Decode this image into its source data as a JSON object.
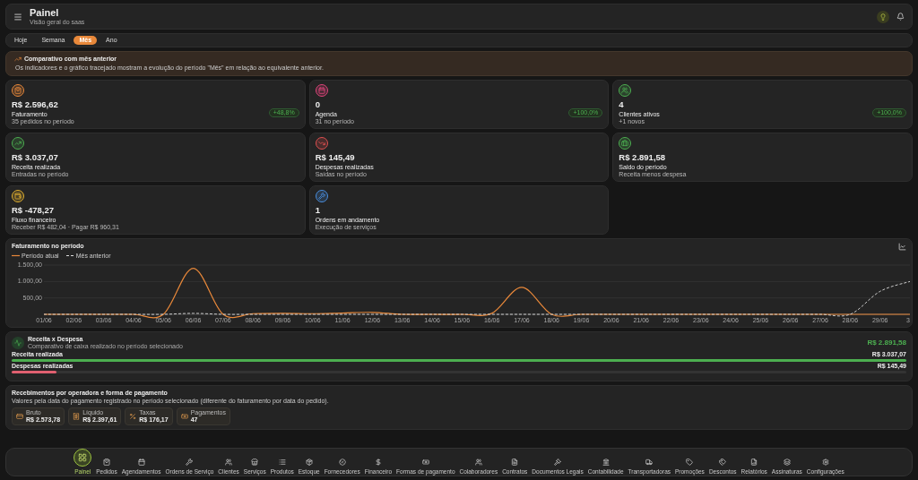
{
  "header": {
    "title": "Painel",
    "subtitle": "Visão geral do saas"
  },
  "period_tabs": [
    {
      "label": "Hoje",
      "selected": false
    },
    {
      "label": "Semana",
      "selected": false
    },
    {
      "label": "Mês",
      "selected": true
    },
    {
      "label": "Ano",
      "selected": false
    }
  ],
  "banner": {
    "title": "Comparativo com mês anterior",
    "text": "Os indicadores e o gráfico tracejado mostram a evolução do período \"Mês\" em relação ao equivalente anterior."
  },
  "cards": [
    {
      "value": "R$ 2.596,62",
      "label": "Faturamento",
      "sub": "35 pedidos no período",
      "badge": "+48,8%"
    },
    {
      "value": "0",
      "label": "Agenda",
      "sub": "31 no período",
      "badge": "+100,0%"
    },
    {
      "value": "4",
      "label": "Clientes ativos",
      "sub": "+1 novos",
      "badge": "+100,0%"
    },
    {
      "value": "R$ 3.037,07",
      "label": "Receita realizada",
      "sub": "Entradas no período"
    },
    {
      "value": "R$ 145,49",
      "label": "Despesas realizadas",
      "sub": "Saídas no período"
    },
    {
      "value": "R$ 2.891,58",
      "label": "Saldo do período",
      "sub": "Receita menos despesa"
    },
    {
      "value": "R$ -478,27",
      "label": "Fluxo financeiro",
      "sub": "Receber R$ 482,04 · Pagar R$ 960,31"
    },
    {
      "value": "1",
      "label": "Ordens em andamento",
      "sub": "Execução de serviços"
    }
  ],
  "revenue_chart": {
    "title": "Faturamento no período",
    "chart_data": {
      "type": "line",
      "categories": [
        "01/06",
        "02/06",
        "03/06",
        "04/06",
        "05/06",
        "06/06",
        "07/06",
        "08/06",
        "09/06",
        "10/06",
        "11/06",
        "12/06",
        "13/06",
        "14/06",
        "15/06",
        "16/06",
        "17/06",
        "18/06",
        "19/06",
        "20/06",
        "21/06",
        "22/06",
        "23/06",
        "24/06",
        "25/06",
        "26/06",
        "27/06",
        "28/06",
        "29/06",
        "3"
      ],
      "series": [
        {
          "name": "Período atual",
          "color": "#e8883a",
          "line_style": "solid",
          "values": [
            0,
            0,
            0,
            0,
            0,
            1400,
            0,
            20,
            30,
            20,
            40,
            60,
            0,
            0,
            0,
            30,
            820,
            0,
            0,
            0,
            0,
            0,
            0,
            0,
            0,
            0,
            0,
            0,
            0,
            0
          ]
        },
        {
          "name": "Mês anterior",
          "color": "#dddddd",
          "line_style": "dashed",
          "values": [
            0,
            0,
            0,
            0,
            0,
            30,
            0,
            0,
            0,
            0,
            0,
            0,
            0,
            0,
            0,
            0,
            0,
            0,
            0,
            0,
            0,
            0,
            0,
            0,
            0,
            0,
            0,
            0,
            700,
            1000
          ]
        }
      ],
      "ylim": [
        0,
        1500
      ],
      "yticks": [
        {
          "value": 500,
          "label": "500,00"
        },
        {
          "value": 1000,
          "label": "1.000,00"
        },
        {
          "value": 1500,
          "label": "1.500,00"
        }
      ]
    }
  },
  "cash": {
    "title": "Receita x Despesa",
    "subtitle": "Comparativo de caixa realizado no período selecionado",
    "total": "R$ 2.891,58",
    "rows": [
      {
        "label": "Receita realizada",
        "value": "R$ 3.037,07",
        "level": 1,
        "color": "#4caf50"
      },
      {
        "label": "Despesas realizadas",
        "value": "R$ 145,49",
        "level": 0.05,
        "color": "#e06070"
      }
    ]
  },
  "receipts": {
    "title": "Recebimentos por operadora e forma de pagamento",
    "subtitle": "Valores pela data do pagamento registrado no período selecionado (diferente do faturamento por data do pedido).",
    "chips": [
      {
        "label": "Bruto",
        "value": "R$ 2.573,78"
      },
      {
        "label": "Líquido",
        "value": "R$ 2.397,61"
      },
      {
        "label": "Taxas",
        "value": "R$ 176,17"
      },
      {
        "label": "Pagamentos",
        "value": "47"
      }
    ]
  },
  "nav": [
    {
      "label": "Painel",
      "selected": true
    },
    {
      "label": "Pedidos",
      "selected": false
    },
    {
      "label": "Agendamentos",
      "selected": false
    },
    {
      "label": "Ordens de Serviço",
      "selected": false
    },
    {
      "label": "Clientes",
      "selected": false
    },
    {
      "label": "Serviços",
      "selected": false
    },
    {
      "label": "Produtos",
      "selected": false
    },
    {
      "label": "Estoque",
      "selected": false
    },
    {
      "label": "Fornecedores",
      "selected": false
    },
    {
      "label": "Financeiro",
      "selected": false
    },
    {
      "label": "Formas de pagamento",
      "selected": false
    },
    {
      "label": "Colaboradores",
      "selected": false
    },
    {
      "label": "Contratos",
      "selected": false
    },
    {
      "label": "Documentos Legais",
      "selected": false
    },
    {
      "label": "Contabilidade",
      "selected": false
    },
    {
      "label": "Transportadoras",
      "selected": false
    },
    {
      "label": "Promoções",
      "selected": false
    },
    {
      "label": "Descontos",
      "selected": false
    },
    {
      "label": "Relatórios",
      "selected": false
    },
    {
      "label": "Assinaturas",
      "selected": false
    },
    {
      "label": "Configurações",
      "selected": false
    }
  ]
}
